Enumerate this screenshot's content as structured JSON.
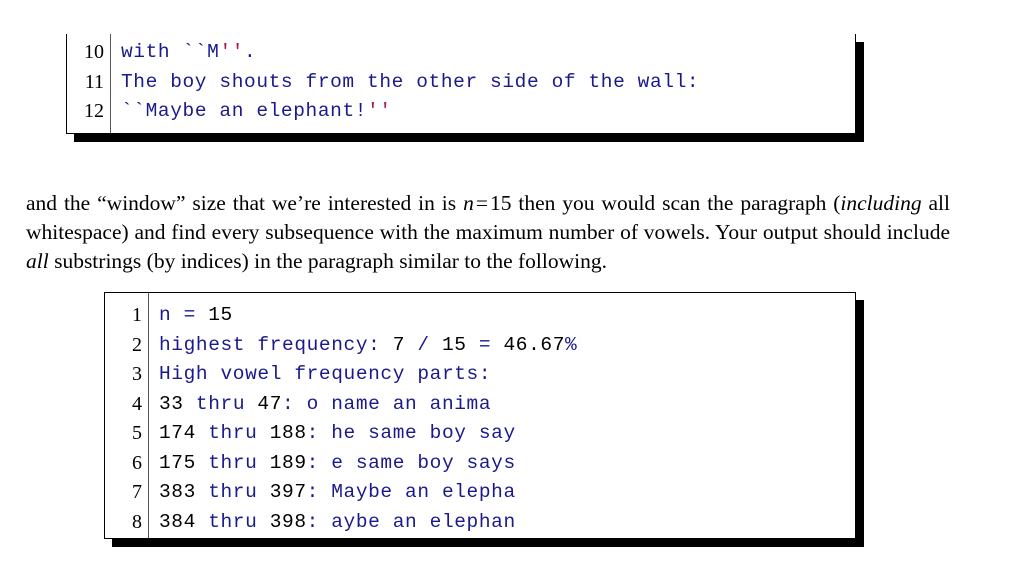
{
  "document": {
    "type": "latex-typeset-page",
    "colors": {
      "code_keyword": "#1a1a8c",
      "code_number": "#000000",
      "code_quote_close": "#a02040",
      "line_number": "#000000",
      "body_text": "#000000",
      "box_border": "#000000",
      "box_shadow": "#000000",
      "page_background": "#ffffff"
    }
  },
  "listing_top": {
    "name": "code-listing-continued",
    "clipped_at_top": true,
    "line_numbers": [
      "10",
      "11",
      "12"
    ],
    "lines": [
      {
        "number": "10",
        "text": "with ``M''.",
        "tokens": [
          {
            "t": "with ",
            "style": "kw"
          },
          {
            "t": "``",
            "style": "q-open"
          },
          {
            "t": "M",
            "style": "kw"
          },
          {
            "t": "''",
            "style": "q-close"
          },
          {
            "t": ".",
            "style": "kw"
          }
        ]
      },
      {
        "number": "11",
        "text": "The boy shouts from the other side of the wall:",
        "tokens": [
          {
            "t": "The boy shouts from the other side of the wall:",
            "style": "kw"
          }
        ]
      },
      {
        "number": "12",
        "text": "``Maybe an elephant!''",
        "tokens": [
          {
            "t": "``",
            "style": "q-open"
          },
          {
            "t": "Maybe an elephant!",
            "style": "kw"
          },
          {
            "t": "''",
            "style": "q-close"
          }
        ]
      }
    ]
  },
  "paragraph": {
    "name": "body-paragraph",
    "full_text": "and the “window” size that we’re interested in is n = 15 then you would scan the paragraph (including all whitespace) and find every subsequence with the maximum number of vowels. Your output should include all substrings (by indices) in the paragraph similar to the following.",
    "segments": [
      {
        "t": "and the “window” size that we’re interested in is ",
        "style": "roman"
      },
      {
        "t": "n",
        "style": "math"
      },
      {
        "t": "=",
        "style": "mathop"
      },
      {
        "t": "15",
        "style": "mathnum"
      },
      {
        "t": " then you would scan the para­graph (",
        "style": "roman"
      },
      {
        "t": "including",
        "style": "italic"
      },
      {
        "t": " all whitespace) and find every subsequence with the maximum number of vowels. Your output should include ",
        "style": "roman"
      },
      {
        "t": "all",
        "style": "italic"
      },
      {
        "t": " substrings (by indices) in the paragraph similar to the following.",
        "style": "roman"
      }
    ]
  },
  "listing_bottom": {
    "name": "code-listing-output",
    "clipped_at_top": false,
    "line_numbers": [
      "1",
      "2",
      "3",
      "4",
      "5",
      "6",
      "7",
      "8"
    ],
    "lines": [
      {
        "number": "1",
        "text": "n = 15",
        "tokens": [
          {
            "t": "n = ",
            "style": "kw"
          },
          {
            "t": "15",
            "style": "num"
          }
        ]
      },
      {
        "number": "2",
        "text": "highest frequency: 7 / 15 = 46.67%",
        "tokens": [
          {
            "t": "highest frequency: ",
            "style": "kw"
          },
          {
            "t": "7",
            "style": "num"
          },
          {
            "t": " / ",
            "style": "kw"
          },
          {
            "t": "15",
            "style": "num"
          },
          {
            "t": " = ",
            "style": "kw"
          },
          {
            "t": "46.67",
            "style": "num"
          },
          {
            "t": "%",
            "style": "kw"
          }
        ]
      },
      {
        "number": "3",
        "text": "High vowel frequency parts:",
        "tokens": [
          {
            "t": "High vowel frequency parts:",
            "style": "kw"
          }
        ]
      },
      {
        "number": "4",
        "text": "33 thru 47: o name an anima",
        "tokens": [
          {
            "t": "33",
            "style": "num"
          },
          {
            "t": " thru ",
            "style": "kw"
          },
          {
            "t": "47",
            "style": "num"
          },
          {
            "t": ": o name an anima",
            "style": "kw"
          }
        ]
      },
      {
        "number": "5",
        "text": "174 thru 188: he same boy say",
        "tokens": [
          {
            "t": "174",
            "style": "num"
          },
          {
            "t": " thru ",
            "style": "kw"
          },
          {
            "t": "188",
            "style": "num"
          },
          {
            "t": ": he same boy say",
            "style": "kw"
          }
        ]
      },
      {
        "number": "6",
        "text": "175 thru 189: e same boy says",
        "tokens": [
          {
            "t": "175",
            "style": "num"
          },
          {
            "t": " thru ",
            "style": "kw"
          },
          {
            "t": "189",
            "style": "num"
          },
          {
            "t": ": e same boy says",
            "style": "kw"
          }
        ]
      },
      {
        "number": "7",
        "text": "383 thru 397: Maybe an elepha",
        "tokens": [
          {
            "t": "383",
            "style": "num"
          },
          {
            "t": " thru ",
            "style": "kw"
          },
          {
            "t": "397",
            "style": "num"
          },
          {
            "t": ": Maybe an elepha",
            "style": "kw"
          }
        ]
      },
      {
        "number": "8",
        "text": "384 thru 398: aybe an elephan",
        "tokens": [
          {
            "t": "384",
            "style": "num"
          },
          {
            "t": " thru ",
            "style": "kw"
          },
          {
            "t": "398",
            "style": "num"
          },
          {
            "t": ": aybe an elephan",
            "style": "kw"
          }
        ]
      }
    ]
  }
}
